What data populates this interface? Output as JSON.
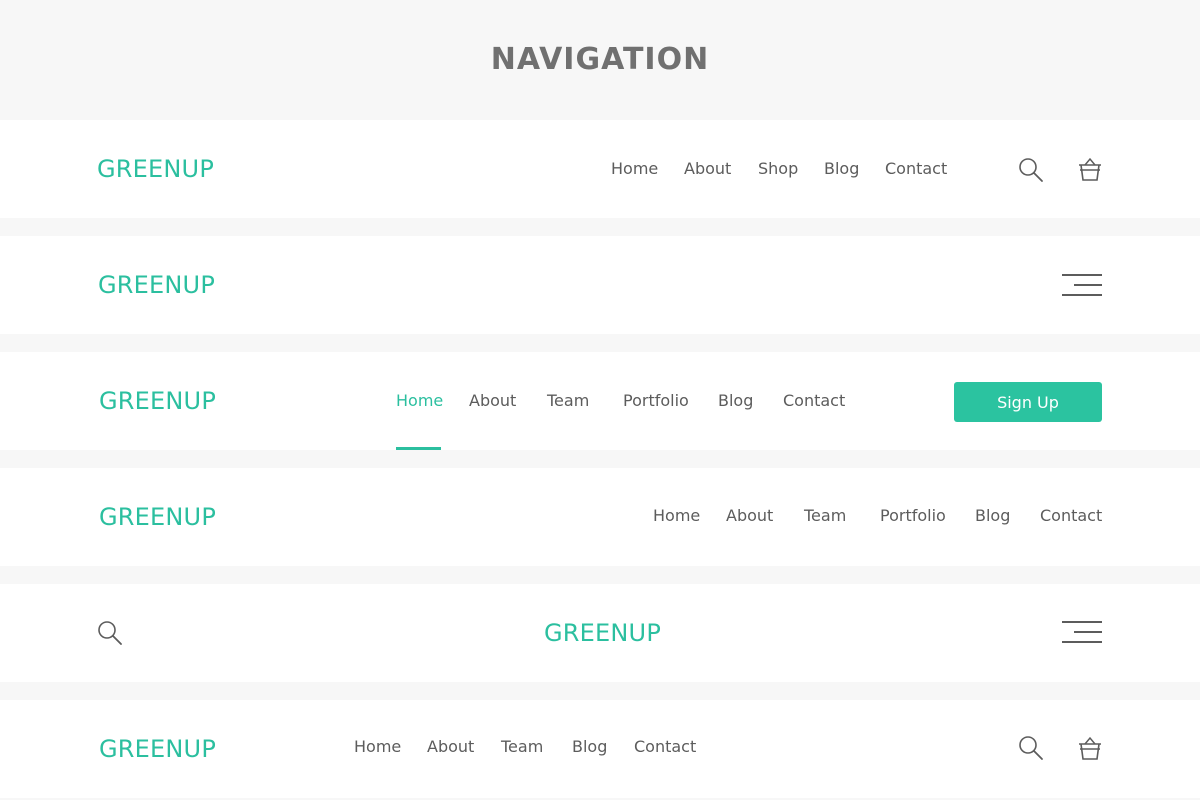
{
  "page": {
    "title": "NAVIGATION"
  },
  "brand": {
    "logo": "GREENUP",
    "accent": "#2bbf9f"
  },
  "bars": [
    {
      "nav": [
        "Home",
        "About",
        "Shop",
        "Blog",
        "Contact"
      ],
      "icons": [
        "search-icon",
        "basket-icon"
      ]
    },
    {
      "nav": [],
      "icons": [
        "hamburger-menu-icon"
      ]
    },
    {
      "nav": [
        "Home",
        "About",
        "Team",
        "Portfolio",
        "Blog",
        "Contact"
      ],
      "active": "Home",
      "cta": "Sign Up"
    },
    {
      "nav": [
        "Home",
        "About",
        "Team",
        "Portfolio",
        "Blog",
        "Contact"
      ]
    },
    {
      "nav": [],
      "icons": [
        "search-icon",
        "hamburger-menu-icon"
      ]
    },
    {
      "nav": [
        "Home",
        "About",
        "Team",
        "Blog",
        "Contact"
      ],
      "icons": [
        "search-icon",
        "basket-icon"
      ]
    }
  ]
}
